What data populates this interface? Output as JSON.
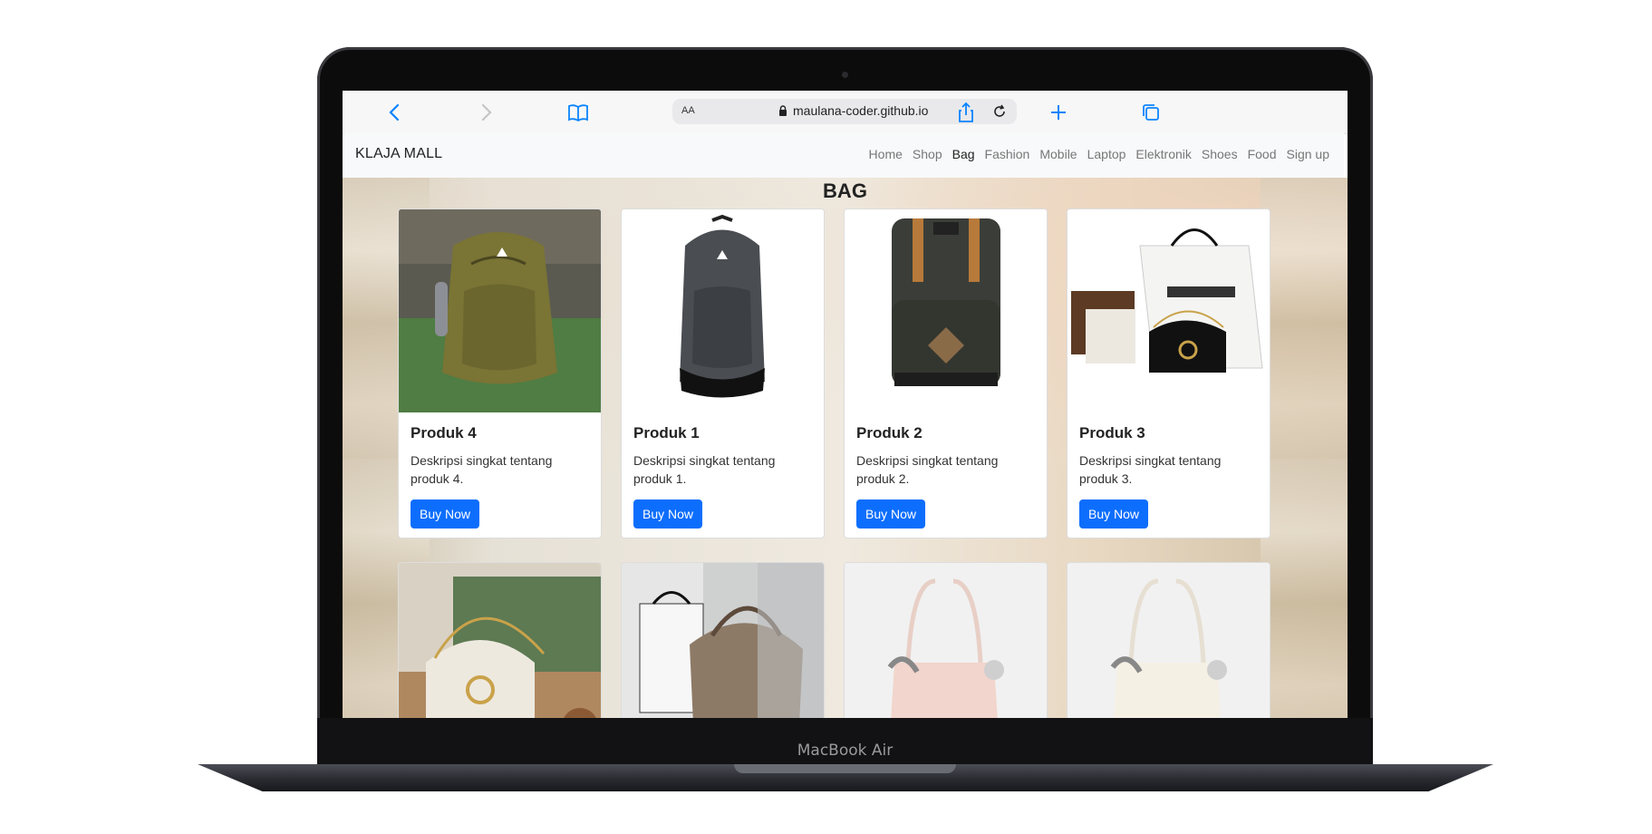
{
  "device": {
    "model_label": "MacBook Air"
  },
  "browser": {
    "text_size_label": "AA",
    "url": "maulana-coder.github.io"
  },
  "navbar": {
    "brand": "KLAJA MALL",
    "links": [
      "Home",
      "Shop",
      "Bag",
      "Fashion",
      "Mobile",
      "Laptop",
      "Elektronik",
      "Shoes",
      "Food",
      "Sign up"
    ],
    "active": "Bag"
  },
  "page": {
    "heading": "BAG",
    "products": [
      {
        "title": "Produk 4",
        "description": "Deskripsi singkat tentang produk 4.",
        "button": "Buy Now"
      },
      {
        "title": "Produk 1",
        "description": "Deskripsi singkat tentang produk 1.",
        "button": "Buy Now"
      },
      {
        "title": "Produk 2",
        "description": "Deskripsi singkat tentang produk 2.",
        "button": "Buy Now"
      },
      {
        "title": "Produk 3",
        "description": "Deskripsi singkat tentang produk 3.",
        "button": "Buy Now"
      }
    ],
    "product_images": {
      "row1": [
        "olive-backpack",
        "grey-backpack",
        "dark-green-backpack",
        "gucci-box-set"
      ],
      "row2": [
        "gucci-white-crossbody",
        "gucci-hobo-bag",
        "pink-tote",
        "cream-tote"
      ]
    }
  },
  "colors": {
    "primary_button": "#0d6efd",
    "safari_blue": "#0a84ff",
    "navbar_bg": "#f8f9fa"
  }
}
